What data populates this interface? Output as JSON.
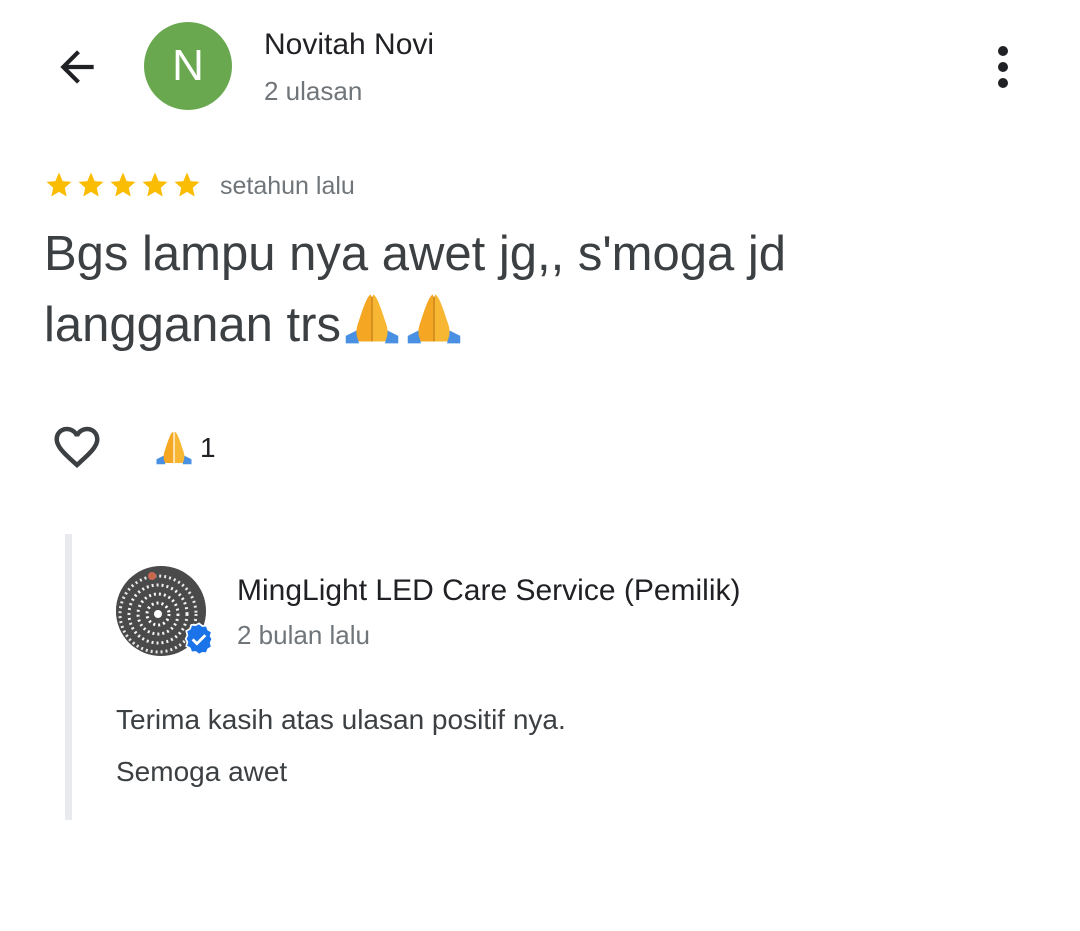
{
  "header": {
    "author_initial": "N",
    "author_name": "Novitah Novi",
    "author_review_count": "2 ulasan",
    "avatar_color": "#6aa84f"
  },
  "review": {
    "rating": 5,
    "max_rating": 5,
    "star_color": "#fbbc04",
    "time_ago": "setahun lalu",
    "text": "Bgs lampu nya awet jg,, s'moga jd langganan trs",
    "trailing_emoji": "folded-hands x2"
  },
  "reactions": {
    "emoji": "folded-hands",
    "count": "1"
  },
  "owner_reply": {
    "name": "MingLight LED Care Service (Pemilik)",
    "time_ago": "2 bulan lalu",
    "lines": [
      "Terima kasih atas ulasan positif nya.",
      "Semoga awet"
    ],
    "verified_color": "#1a73e8"
  }
}
